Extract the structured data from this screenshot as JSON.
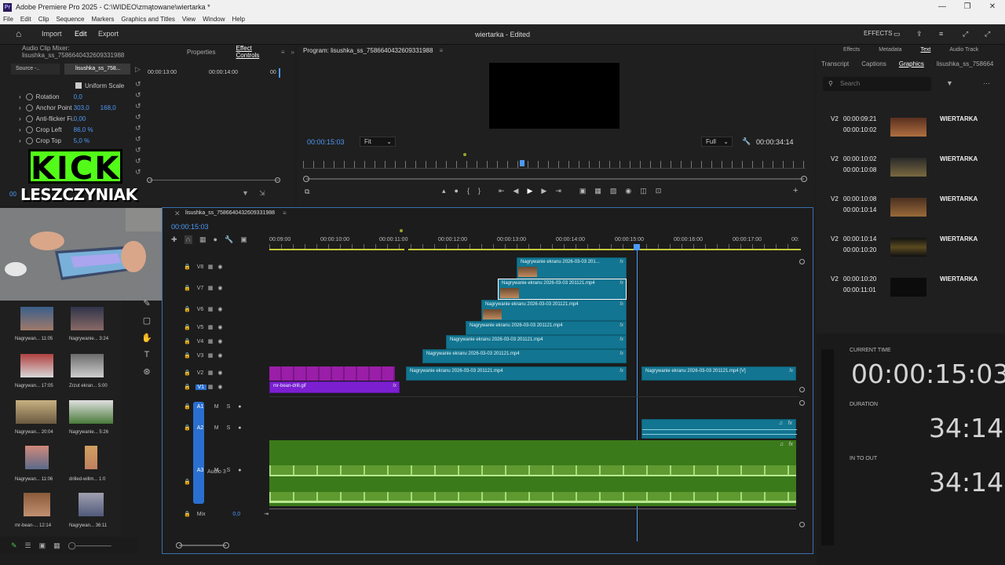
{
  "window": {
    "app_icon": "Pr",
    "title": "Adobe Premiere Pro 2025 - C:\\WIDEO\\zmątowane\\wiertarka *"
  },
  "menu": [
    "File",
    "Edit",
    "Clip",
    "Sequence",
    "Markers",
    "Graphics and Titles",
    "View",
    "Window",
    "Help"
  ],
  "header": {
    "import": "Import",
    "edit": "Edit",
    "export": "Export",
    "document": "wiertarka - Edited",
    "effects": "EFFECTS"
  },
  "source_panel": {
    "tabs": [
      "Audio Clip Mixer: lisushka_ss_7586640432609331988",
      "Properties",
      "Effect Controls"
    ],
    "source_tab": "Source -..",
    "clip_tab": "lisushka_ss_758...",
    "ruler": [
      "00:00:13:00",
      "00:00:14:00",
      "00"
    ],
    "uniform_scale": "Uniform Scale",
    "props": [
      {
        "name": "Rotation",
        "v1": "0,0",
        "v2": ""
      },
      {
        "name": "Anchor Point",
        "v1": "303,0",
        "v2": "168,0"
      },
      {
        "name": "Anti-flicker Fi...",
        "v1": "0,00",
        "v2": ""
      },
      {
        "name": "Crop Left",
        "v1": "86,0 %",
        "v2": ""
      },
      {
        "name": "Crop Top",
        "v1": "5,0 %",
        "v2": ""
      }
    ],
    "timecode": "00"
  },
  "overlay": {
    "kick": "KICK",
    "name": "LESZCZYNIAK"
  },
  "program": {
    "title": "Program: lisushka_ss_7586640432609331988",
    "timecode": "00:00:15:03",
    "fit": "Fit",
    "quality": "Full",
    "duration": "00:00:34:14"
  },
  "right_panel": {
    "top_tabs": [
      "Effects",
      "Metadata",
      "Text",
      "Audio Track"
    ],
    "sub_tabs": [
      "Transcript",
      "Captions",
      "Graphics",
      "lisushka_ss_758664"
    ],
    "search_placeholder": "Search",
    "graphics": [
      {
        "track": "V2",
        "in": "00:00:09:21",
        "out": "00:00:10:02",
        "name": "WIERTARKA"
      },
      {
        "track": "V2",
        "in": "00:00:10:02",
        "out": "00:00:10:08",
        "name": "WIERTARKA"
      },
      {
        "track": "V2",
        "in": "00:00:10:08",
        "out": "00:00:10:14",
        "name": "WIERTARKA"
      },
      {
        "track": "V2",
        "in": "00:00:10:14",
        "out": "00:00:10:20",
        "name": "WIERTARKA"
      },
      {
        "track": "V2",
        "in": "00:00:10:20",
        "out": "00:00:11:01",
        "name": "WIERTARKA"
      }
    ]
  },
  "timecode_panel": {
    "current_label": "CURRENT TIME",
    "current": "00:00:15:03",
    "duration_label": "DURATION",
    "duration": "34:14",
    "inout_label": "IN TO OUT",
    "inout": "34:14"
  },
  "project": {
    "items": [
      {
        "name": "Nagrywan...",
        "dur": "11:05"
      },
      {
        "name": "Nagrywanie...",
        "dur": "3:24"
      },
      {
        "name": "Nagrywan...",
        "dur": "17:05"
      },
      {
        "name": "Zrzut ekran...",
        "dur": "5:00"
      },
      {
        "name": "Nagrywan...",
        "dur": "20:04"
      },
      {
        "name": "Nagrywanie...",
        "dur": "5:26"
      },
      {
        "name": "Nagrywan...",
        "dur": "11:06"
      },
      {
        "name": "drilled-willm...",
        "dur": "1:0"
      },
      {
        "name": "mr-bean-...",
        "dur": "12:14"
      },
      {
        "name": "Nagrywan...",
        "dur": "36:11"
      }
    ]
  },
  "timeline": {
    "sequence": "lisushka_ss_7586640432609331988",
    "timecode": "00:00:15:03",
    "ruler": [
      "00:09:00",
      "00:00:10:00",
      "00:00:11:00",
      "00:00:12:00",
      "00:00:13:00",
      "00:00:14:00",
      "00:00:15:00",
      "00:00:16:00",
      "00:00:17:00",
      "00:"
    ],
    "video_tracks": [
      "V8",
      "V7",
      "V6",
      "V5",
      "V4",
      "V3",
      "V2",
      "V1"
    ],
    "audio_tracks": [
      "A1",
      "A2",
      "A3"
    ],
    "audio3_name": "Audio 3",
    "mix": "Mix",
    "mix_value": "0,0",
    "clip_name": "Nagrywanie ekranu 2026-03-03 201121.mp4",
    "clip_name_short": "Nagrywanie ekranu 2026-03-03 201...",
    "clip_name_v": "Nagrywanie ekranu 2026-03-03 201121.mp4 [V]",
    "gif_name": "mr-bean-drill.gif",
    "fx": "fx",
    "m": "M",
    "s": "S",
    "l": "L",
    "r": "R"
  }
}
